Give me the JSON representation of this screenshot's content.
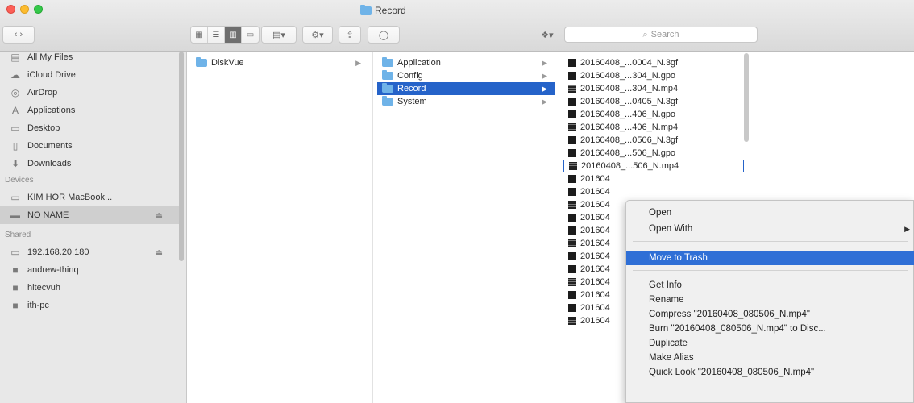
{
  "window": {
    "title": "Record"
  },
  "toolbar": {
    "view_modes": [
      "icon-view",
      "list-view",
      "column-view",
      "cover-flow-view"
    ],
    "search_placeholder": "Search"
  },
  "sidebar": {
    "favorites": [
      {
        "label": "All My Files",
        "icon": "all-files-icon"
      },
      {
        "label": "iCloud Drive",
        "icon": "cloud-icon"
      },
      {
        "label": "AirDrop",
        "icon": "airdrop-icon"
      },
      {
        "label": "Applications",
        "icon": "applications-icon"
      },
      {
        "label": "Desktop",
        "icon": "desktop-icon"
      },
      {
        "label": "Documents",
        "icon": "documents-icon"
      },
      {
        "label": "Downloads",
        "icon": "downloads-icon"
      }
    ],
    "devices_header": "Devices",
    "devices": [
      {
        "label": "KIM HOR MacBook...",
        "icon": "laptop-icon"
      },
      {
        "label": "NO NAME",
        "icon": "drive-icon",
        "selected": true
      }
    ],
    "shared_header": "Shared",
    "shared": [
      {
        "label": "192.168.20.180",
        "icon": "network-icon"
      },
      {
        "label": "andrew-thinq",
        "icon": "computer-icon"
      },
      {
        "label": "hitecvuh",
        "icon": "computer-icon"
      },
      {
        "label": "ith-pc",
        "icon": "computer-icon"
      }
    ]
  },
  "columns": {
    "col1": [
      {
        "label": "DiskVue"
      }
    ],
    "col2": [
      {
        "label": "Application"
      },
      {
        "label": "Config"
      },
      {
        "label": "Record",
        "selected": true
      },
      {
        "label": "System"
      }
    ],
    "col3": [
      {
        "label": "20160408_...0004_N.3gf",
        "type": "3gp"
      },
      {
        "label": "20160408_...304_N.gpo",
        "type": "3gp"
      },
      {
        "label": "20160408_...304_N.mp4",
        "type": "mp4"
      },
      {
        "label": "20160408_...0405_N.3gf",
        "type": "3gp"
      },
      {
        "label": "20160408_...406_N.gpo",
        "type": "3gp"
      },
      {
        "label": "20160408_...406_N.mp4",
        "type": "mp4"
      },
      {
        "label": "20160408_...0506_N.3gf",
        "type": "3gp"
      },
      {
        "label": "20160408_...506_N.gpo",
        "type": "3gp"
      },
      {
        "label": "20160408_...506_N.mp4",
        "type": "mp4"
      },
      {
        "label": "201604",
        "type": "3gp"
      },
      {
        "label": "201604",
        "type": "3gp"
      },
      {
        "label": "201604",
        "type": "mp4"
      },
      {
        "label": "201604",
        "type": "3gp"
      },
      {
        "label": "201604",
        "type": "3gp"
      },
      {
        "label": "201604",
        "type": "mp4"
      },
      {
        "label": "201604",
        "type": "3gp"
      },
      {
        "label": "201604",
        "type": "3gp"
      },
      {
        "label": "201604",
        "type": "mp4"
      },
      {
        "label": "201604",
        "type": "3gp"
      },
      {
        "label": "201604",
        "type": "3gp"
      },
      {
        "label": "201604",
        "type": "mp4"
      }
    ]
  },
  "context_menu": {
    "open": "Open",
    "open_with": "Open With",
    "move_to_trash": "Move to Trash",
    "get_info": "Get Info",
    "rename": "Rename",
    "compress": "Compress \"20160408_080506_N.mp4\"",
    "burn": "Burn \"20160408_080506_N.mp4\" to Disc...",
    "duplicate": "Duplicate",
    "make_alias": "Make Alias",
    "quick_look": "Quick Look \"20160408_080506_N.mp4\""
  }
}
